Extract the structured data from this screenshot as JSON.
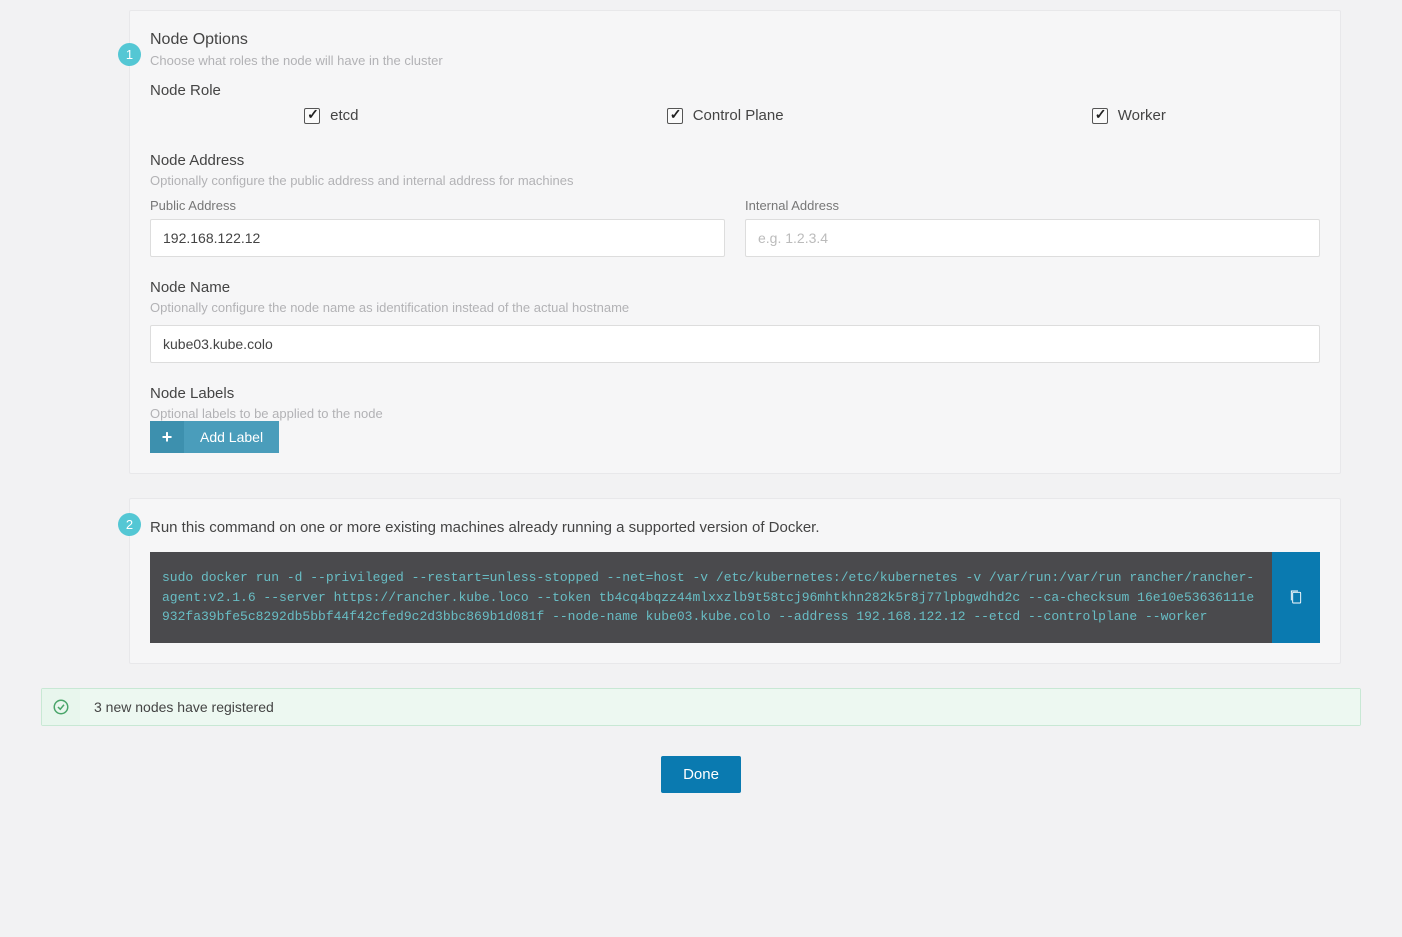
{
  "step1": {
    "badge": "1",
    "title": "Node Options",
    "subtitle": "Choose what roles the node will have in the cluster",
    "role": {
      "label": "Node Role",
      "etcd": "etcd",
      "control_plane": "Control Plane",
      "worker": "Worker"
    },
    "address": {
      "label": "Node Address",
      "subtitle": "Optionally configure the public address and internal address for machines",
      "public_label": "Public Address",
      "public_value": "192.168.122.12",
      "internal_label": "Internal Address",
      "internal_placeholder": "e.g. 1.2.3.4"
    },
    "name": {
      "label": "Node Name",
      "subtitle": "Optionally configure the node name as identification instead of the actual hostname",
      "value": "kube03.kube.colo"
    },
    "labels": {
      "label": "Node Labels",
      "subtitle": "Optional labels to be applied to the node",
      "button": "Add Label"
    }
  },
  "step2": {
    "badge": "2",
    "description": "Run this command on one or more existing machines already running a supported version of Docker.",
    "command": "sudo docker run -d --privileged --restart=unless-stopped --net=host -v /etc/kubernetes:/etc/kubernetes -v /var/run:/var/run rancher/rancher-agent:v2.1.6 --server https://rancher.kube.loco --token tb4cq4bqzz44mlxxzlb9t58tcj96mhtkhn282k5r8j77lpbgwdhd2c --ca-checksum 16e10e53636111e932fa39bfe5c8292db5bbf44f42cfed9c2d3bbc869b1d081f --node-name kube03.kube.colo --address 192.168.122.12 --etcd --controlplane --worker"
  },
  "status": {
    "text": "3 new nodes have registered"
  },
  "done": {
    "label": "Done"
  }
}
